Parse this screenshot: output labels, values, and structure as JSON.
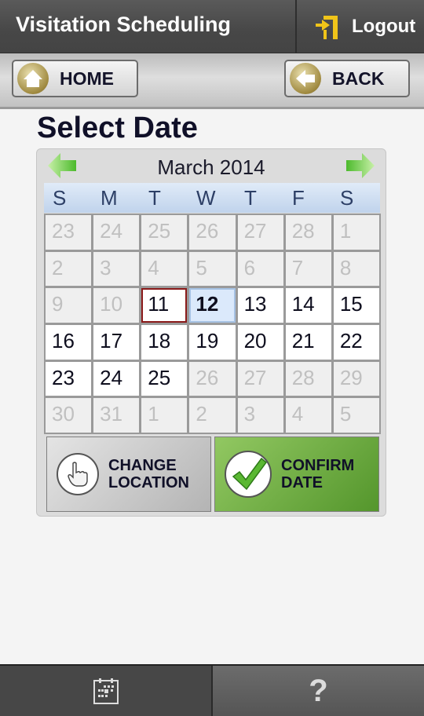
{
  "header": {
    "title": "Visitation Scheduling",
    "logout_label": "Logout",
    "accent": "#f0c419"
  },
  "nav": {
    "home_label": "HOME",
    "back_label": "BACK"
  },
  "page": {
    "title": "Select Date"
  },
  "calendar": {
    "month_label": "March 2014",
    "weekdays": [
      "S",
      "M",
      "T",
      "W",
      "T",
      "F",
      "S"
    ],
    "today": 11,
    "selected": 12,
    "weeks": [
      [
        {
          "d": "23",
          "s": "out"
        },
        {
          "d": "24",
          "s": "out"
        },
        {
          "d": "25",
          "s": "out"
        },
        {
          "d": "26",
          "s": "out"
        },
        {
          "d": "27",
          "s": "out"
        },
        {
          "d": "28",
          "s": "out"
        },
        {
          "d": "1",
          "s": "disabled"
        }
      ],
      [
        {
          "d": "2",
          "s": "disabled"
        },
        {
          "d": "3",
          "s": "disabled"
        },
        {
          "d": "4",
          "s": "disabled"
        },
        {
          "d": "5",
          "s": "disabled"
        },
        {
          "d": "6",
          "s": "disabled"
        },
        {
          "d": "7",
          "s": "disabled"
        },
        {
          "d": "8",
          "s": "disabled"
        }
      ],
      [
        {
          "d": "9",
          "s": "disabled"
        },
        {
          "d": "10",
          "s": "disabled"
        },
        {
          "d": "11",
          "s": "today"
        },
        {
          "d": "12",
          "s": "selected"
        },
        {
          "d": "13",
          "s": "active"
        },
        {
          "d": "14",
          "s": "active"
        },
        {
          "d": "15",
          "s": "active"
        }
      ],
      [
        {
          "d": "16",
          "s": "active"
        },
        {
          "d": "17",
          "s": "active"
        },
        {
          "d": "18",
          "s": "active"
        },
        {
          "d": "19",
          "s": "active"
        },
        {
          "d": "20",
          "s": "active"
        },
        {
          "d": "21",
          "s": "active"
        },
        {
          "d": "22",
          "s": "active"
        }
      ],
      [
        {
          "d": "23",
          "s": "active"
        },
        {
          "d": "24",
          "s": "active"
        },
        {
          "d": "25",
          "s": "active"
        },
        {
          "d": "26",
          "s": "disabled"
        },
        {
          "d": "27",
          "s": "disabled"
        },
        {
          "d": "28",
          "s": "disabled"
        },
        {
          "d": "29",
          "s": "disabled"
        }
      ],
      [
        {
          "d": "30",
          "s": "disabled"
        },
        {
          "d": "31",
          "s": "disabled"
        },
        {
          "d": "1",
          "s": "out"
        },
        {
          "d": "2",
          "s": "out"
        },
        {
          "d": "3",
          "s": "out"
        },
        {
          "d": "4",
          "s": "out"
        },
        {
          "d": "5",
          "s": "out"
        }
      ]
    ]
  },
  "actions": {
    "change_line1": "CHANGE",
    "change_line2": "LOCATION",
    "confirm_line1": "CONFIRM",
    "confirm_line2": "DATE"
  },
  "bottom": {
    "help_label": "?"
  }
}
